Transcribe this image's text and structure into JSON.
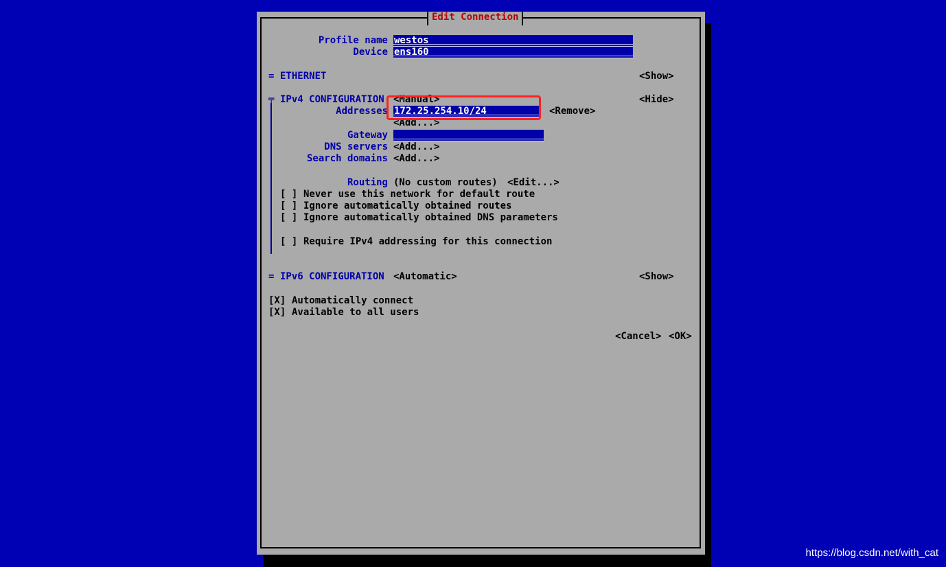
{
  "dialog": {
    "title": "Edit Connection",
    "profile_name_label": "Profile name",
    "profile_name_value": "westos",
    "device_label": "Device",
    "device_value": "ens160",
    "ethernet": {
      "marker": "=",
      "label": "ETHERNET",
      "toggle": "<Show>"
    },
    "ipv4": {
      "marker": "╤",
      "label": "IPv4 CONFIGURATION",
      "mode": "<Manual>",
      "toggle": "<Hide>",
      "addresses_label": "Addresses",
      "address_value": "172.25.254.10/24",
      "remove_button": "<Remove>",
      "add_address_button": "<Add...>",
      "gateway_label": "Gateway",
      "gateway_value": "",
      "dns_label": "DNS servers",
      "dns_add_button": "<Add...>",
      "search_label": "Search domains",
      "search_add_button": "<Add...>",
      "routing_label": "Routing",
      "routing_value": "(No custom routes)",
      "routing_edit_button": "<Edit...>",
      "checkboxes": [
        {
          "box": "[ ]",
          "label": "Never use this network for default route"
        },
        {
          "box": "[ ]",
          "label": "Ignore automatically obtained routes"
        },
        {
          "box": "[ ]",
          "label": "Ignore automatically obtained DNS parameters"
        }
      ],
      "require_box": "[ ]",
      "require_label": "Require IPv4 addressing for this connection"
    },
    "ipv6": {
      "marker": "=",
      "label": "IPv6 CONFIGURATION",
      "mode": "<Automatic>",
      "toggle": "<Show>"
    },
    "auto_connect": {
      "box": "[X]",
      "label": "Automatically connect"
    },
    "all_users": {
      "box": "[X]",
      "label": "Available to all users"
    },
    "cancel_button": "<Cancel>",
    "ok_button": "<OK>"
  },
  "watermark": "https://blog.csdn.net/with_cat"
}
